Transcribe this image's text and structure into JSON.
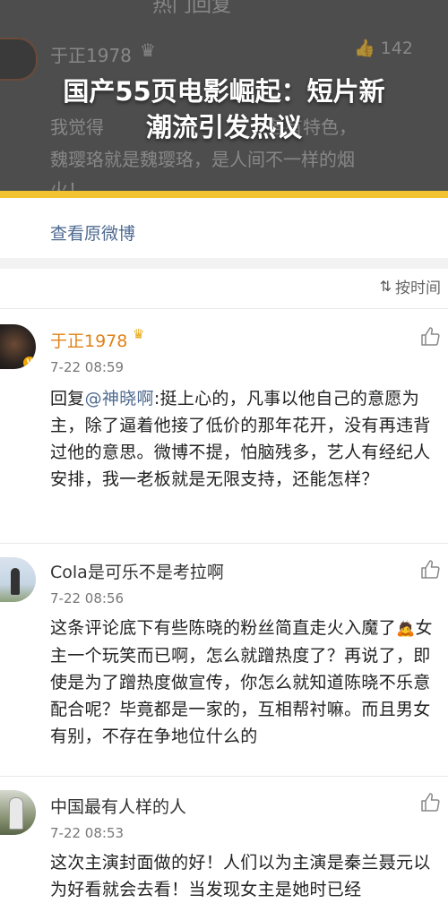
{
  "headline": {
    "line1": "国产55页电影崛起：短片新",
    "line2": "潮流引发热议"
  },
  "prev_post": {
    "top_title": "热门回复",
    "user_name": "于正1978",
    "likes": "142",
    "text_line1": "我觉得",
    "text_line1_end": "各有特色，",
    "text_line2": "魏璎珞就是魏璎珞，是人间不一样的烟",
    "text_line3": "火！"
  },
  "view_original": "查看原微博",
  "sort": {
    "label": "按时间",
    "icon": "sort-icon"
  },
  "comments": [
    {
      "user": "于正1978",
      "verified": true,
      "time": "7-22 08:59",
      "reply_prefix": "回复",
      "mention": "@神晓啊",
      "text": ":挺上心的，凡事以他自己的意愿为主，除了逼着他接了低价的那年花开，没有再违背过他的意思。微博不提，怕脑残多，艺人有经纪人安排，我一老板就是无限支持，还能怎样？"
    },
    {
      "user": "Cola是可乐不是考拉啊",
      "time": "7-22 08:56",
      "text_before_emoji": "这条评论底下有些陈晓的粉丝简直走火入魔了",
      "emoji": "🙇",
      "text_after_emoji": "女主一个玩笑而已啊，怎么就蹭热度了？再说了，即使是为了蹭热度做宣传，你怎么就知道陈晓不乐意配合呢？毕竟都是一家的，互相帮衬嘛。而且男女有别，不存在争地位什么的"
    },
    {
      "user": "中国最有人样的人",
      "time": "7-22 08:53",
      "text": "这次主演封面做的好！人们以为主演是秦兰聂元以为好看就会去看！当发现女主是她时已经"
    }
  ],
  "colors": {
    "banner_bg": "#4d4d4d",
    "accent_bar": "#f2c230",
    "link": "#4e6a90",
    "vip_name": "#e0821a"
  }
}
